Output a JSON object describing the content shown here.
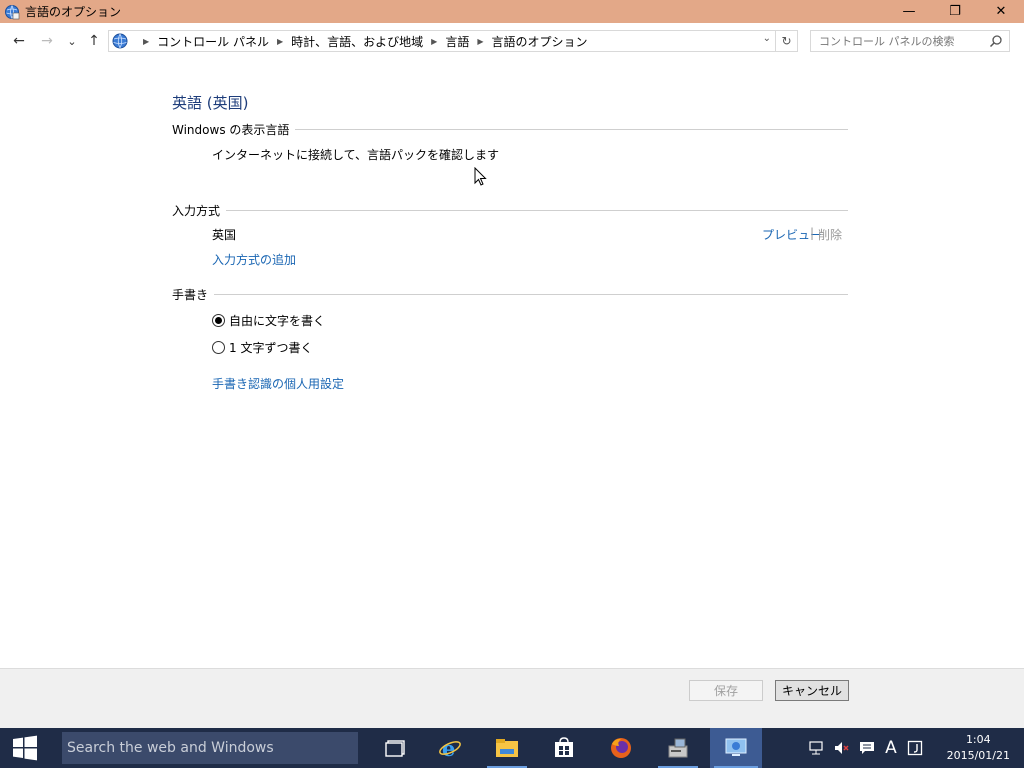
{
  "window": {
    "title": "言語のオプション",
    "minimize": "—",
    "maximize": "❐",
    "close": "✕"
  },
  "nav": {
    "back": "←",
    "forward": "→",
    "recent": "⌄",
    "up": "↑"
  },
  "breadcrumb": {
    "items": [
      "コントロール パネル",
      "時計、言語、および地域",
      "言語",
      "言語のオプション"
    ]
  },
  "search": {
    "placeholder": "コントロール パネルの検索"
  },
  "page": {
    "language_title": "英語 (英国)",
    "display_language": {
      "heading": "Windows の表示言語",
      "status": "インターネットに接続して、言語パックを確認します"
    },
    "input_method": {
      "heading": "入力方式",
      "item": "英国",
      "preview": "プレビュー",
      "separator": "|",
      "remove": "削除",
      "add": "入力方式の追加"
    },
    "handwriting": {
      "heading": "手書き",
      "options": [
        {
          "label": "自由に文字を書く",
          "selected": true
        },
        {
          "label": "1 文字ずつ書く",
          "selected": false
        }
      ],
      "personalize": "手書き認識の個人用設定"
    }
  },
  "footer": {
    "save": "保存",
    "cancel": "キャンセル"
  },
  "taskbar": {
    "search_placeholder": "Search the web and Windows",
    "apps": [
      "task-view-icon",
      "internet-explorer-icon",
      "file-explorer-icon",
      "store-icon",
      "firefox-icon",
      "sysprep-icon",
      "control-panel-icon"
    ],
    "tray_ime": "A",
    "time": "1:04",
    "date": "2015/01/21"
  },
  "colors": {
    "titlebar": "#e3a888",
    "link": "#1a66b3",
    "heading": "#1e3d7b",
    "taskbar": "#1f2c47"
  }
}
